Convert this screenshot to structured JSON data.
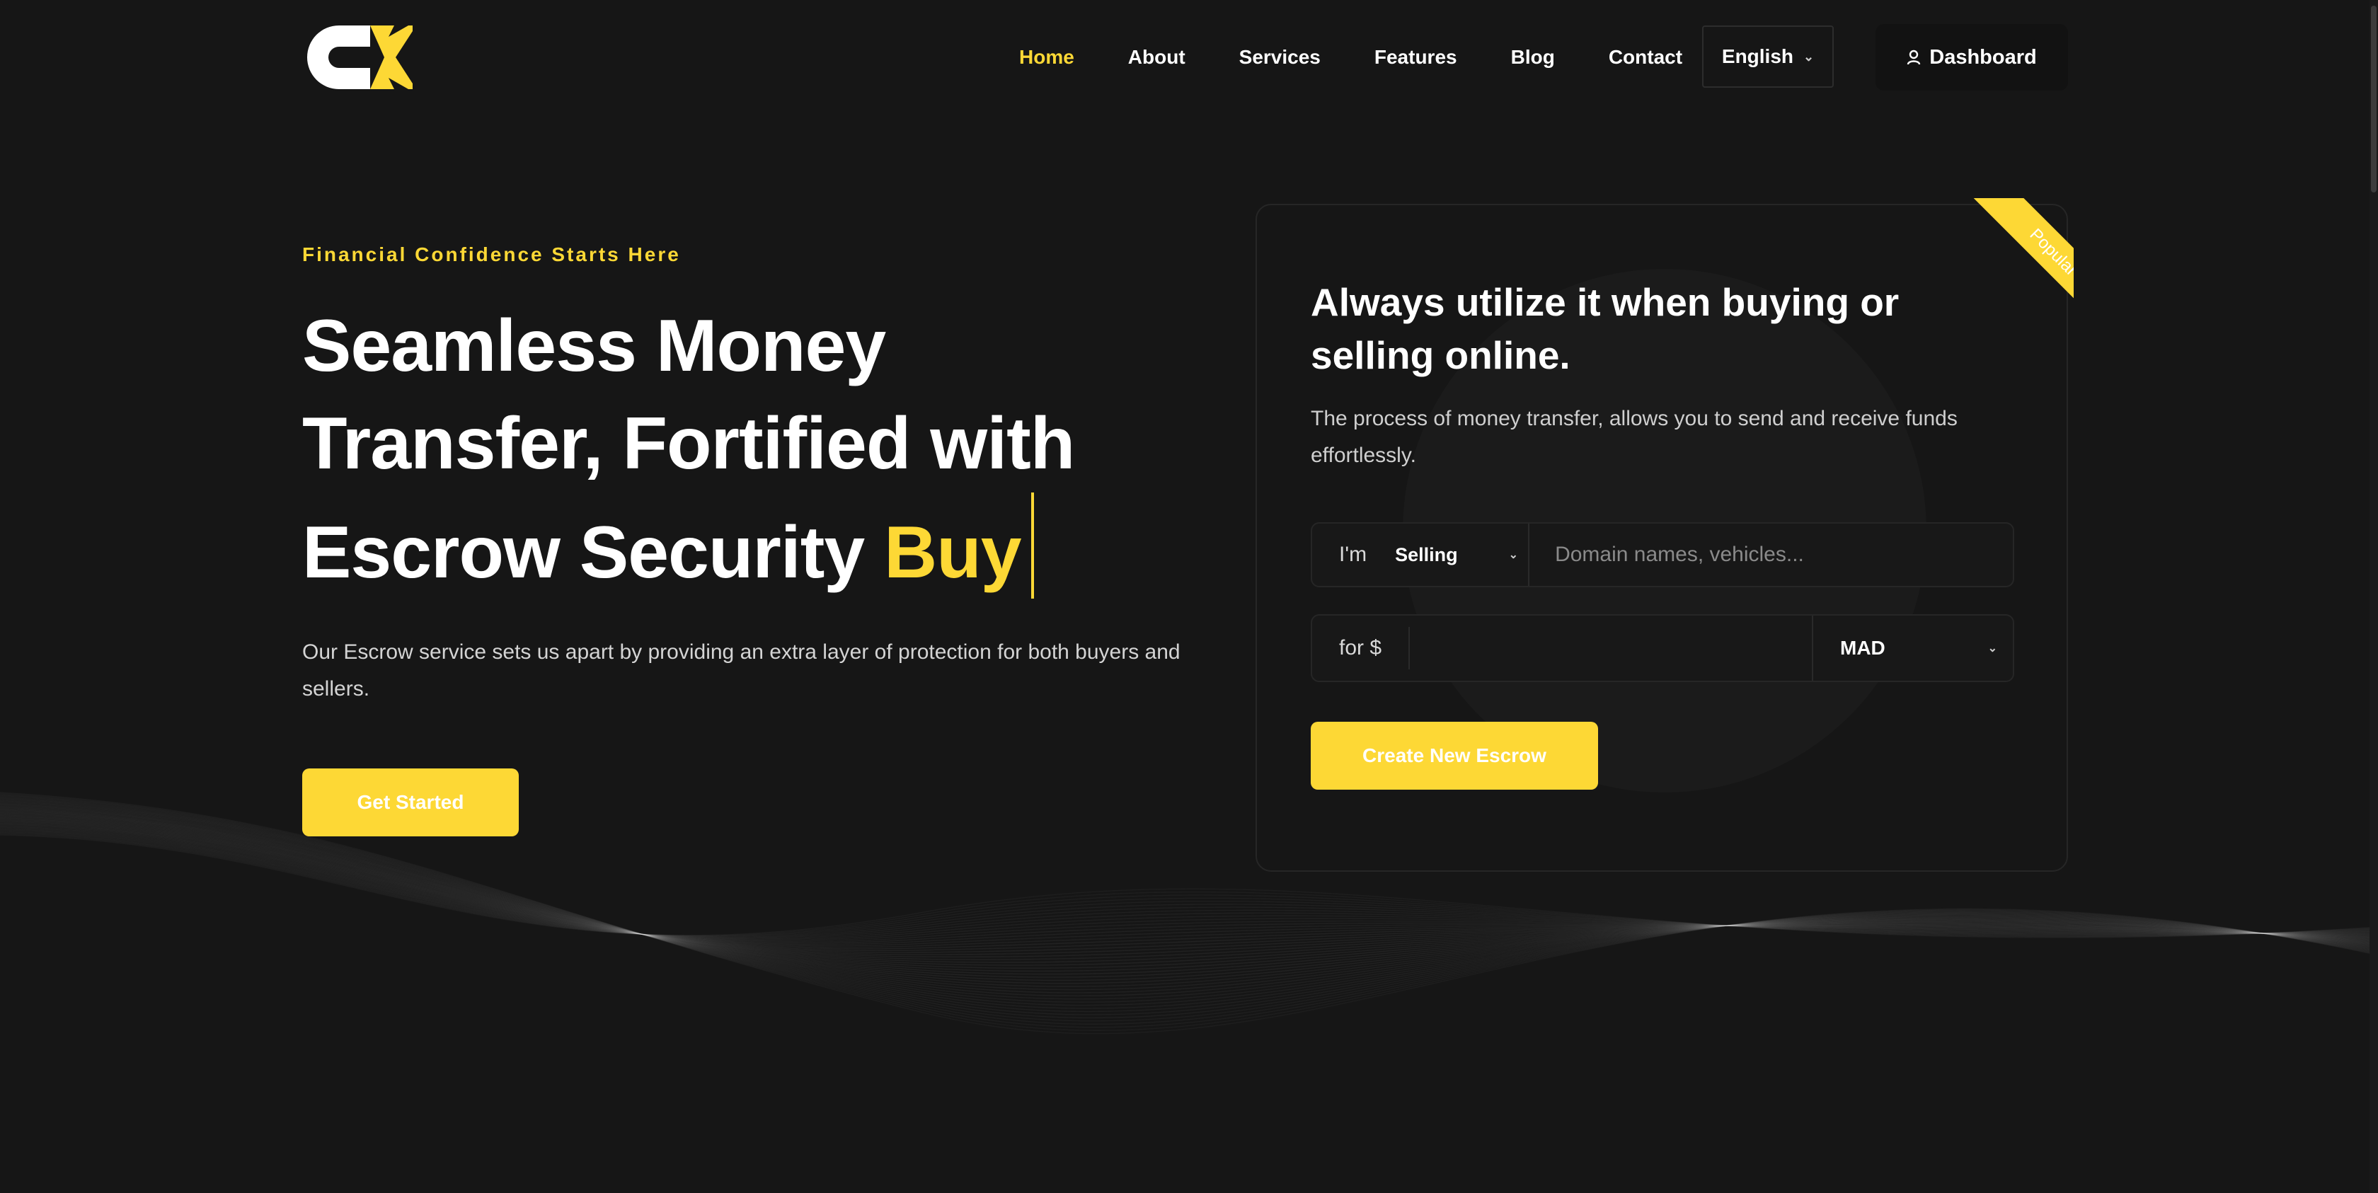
{
  "brand": {
    "name": "cx-logo",
    "accent": "#fdd835",
    "background": "#161616"
  },
  "nav": {
    "items": [
      "Home",
      "About",
      "Services",
      "Features",
      "Blog",
      "Contact"
    ],
    "active": "Home",
    "language": "English",
    "dashboard_label": "Dashboard",
    "dashboard_icon": "user-icon"
  },
  "hero": {
    "eyebrow": "Financial Confidence Starts Here",
    "title_line1": "Seamless Money",
    "title_line2": "Transfer, Fortified with",
    "title_line3": "Escrow Security",
    "title_typed": "Buy",
    "description": "Our Escrow service sets us apart by providing an extra layer of protection for both buyers and sellers.",
    "cta_label": "Get Started"
  },
  "escrow_form": {
    "ribbon": "Popular",
    "title": "Always utilize it when buying or selling online.",
    "description": "The process of money transfer, allows you to send and receive funds effortlessly.",
    "role_prefix": "I'm",
    "role_value": "Selling",
    "item_placeholder": "Domain names, vehicles...",
    "amount_prefix": "for $",
    "amount_value": "",
    "currency_value": "MAD",
    "submit_label": "Create New Escrow"
  }
}
